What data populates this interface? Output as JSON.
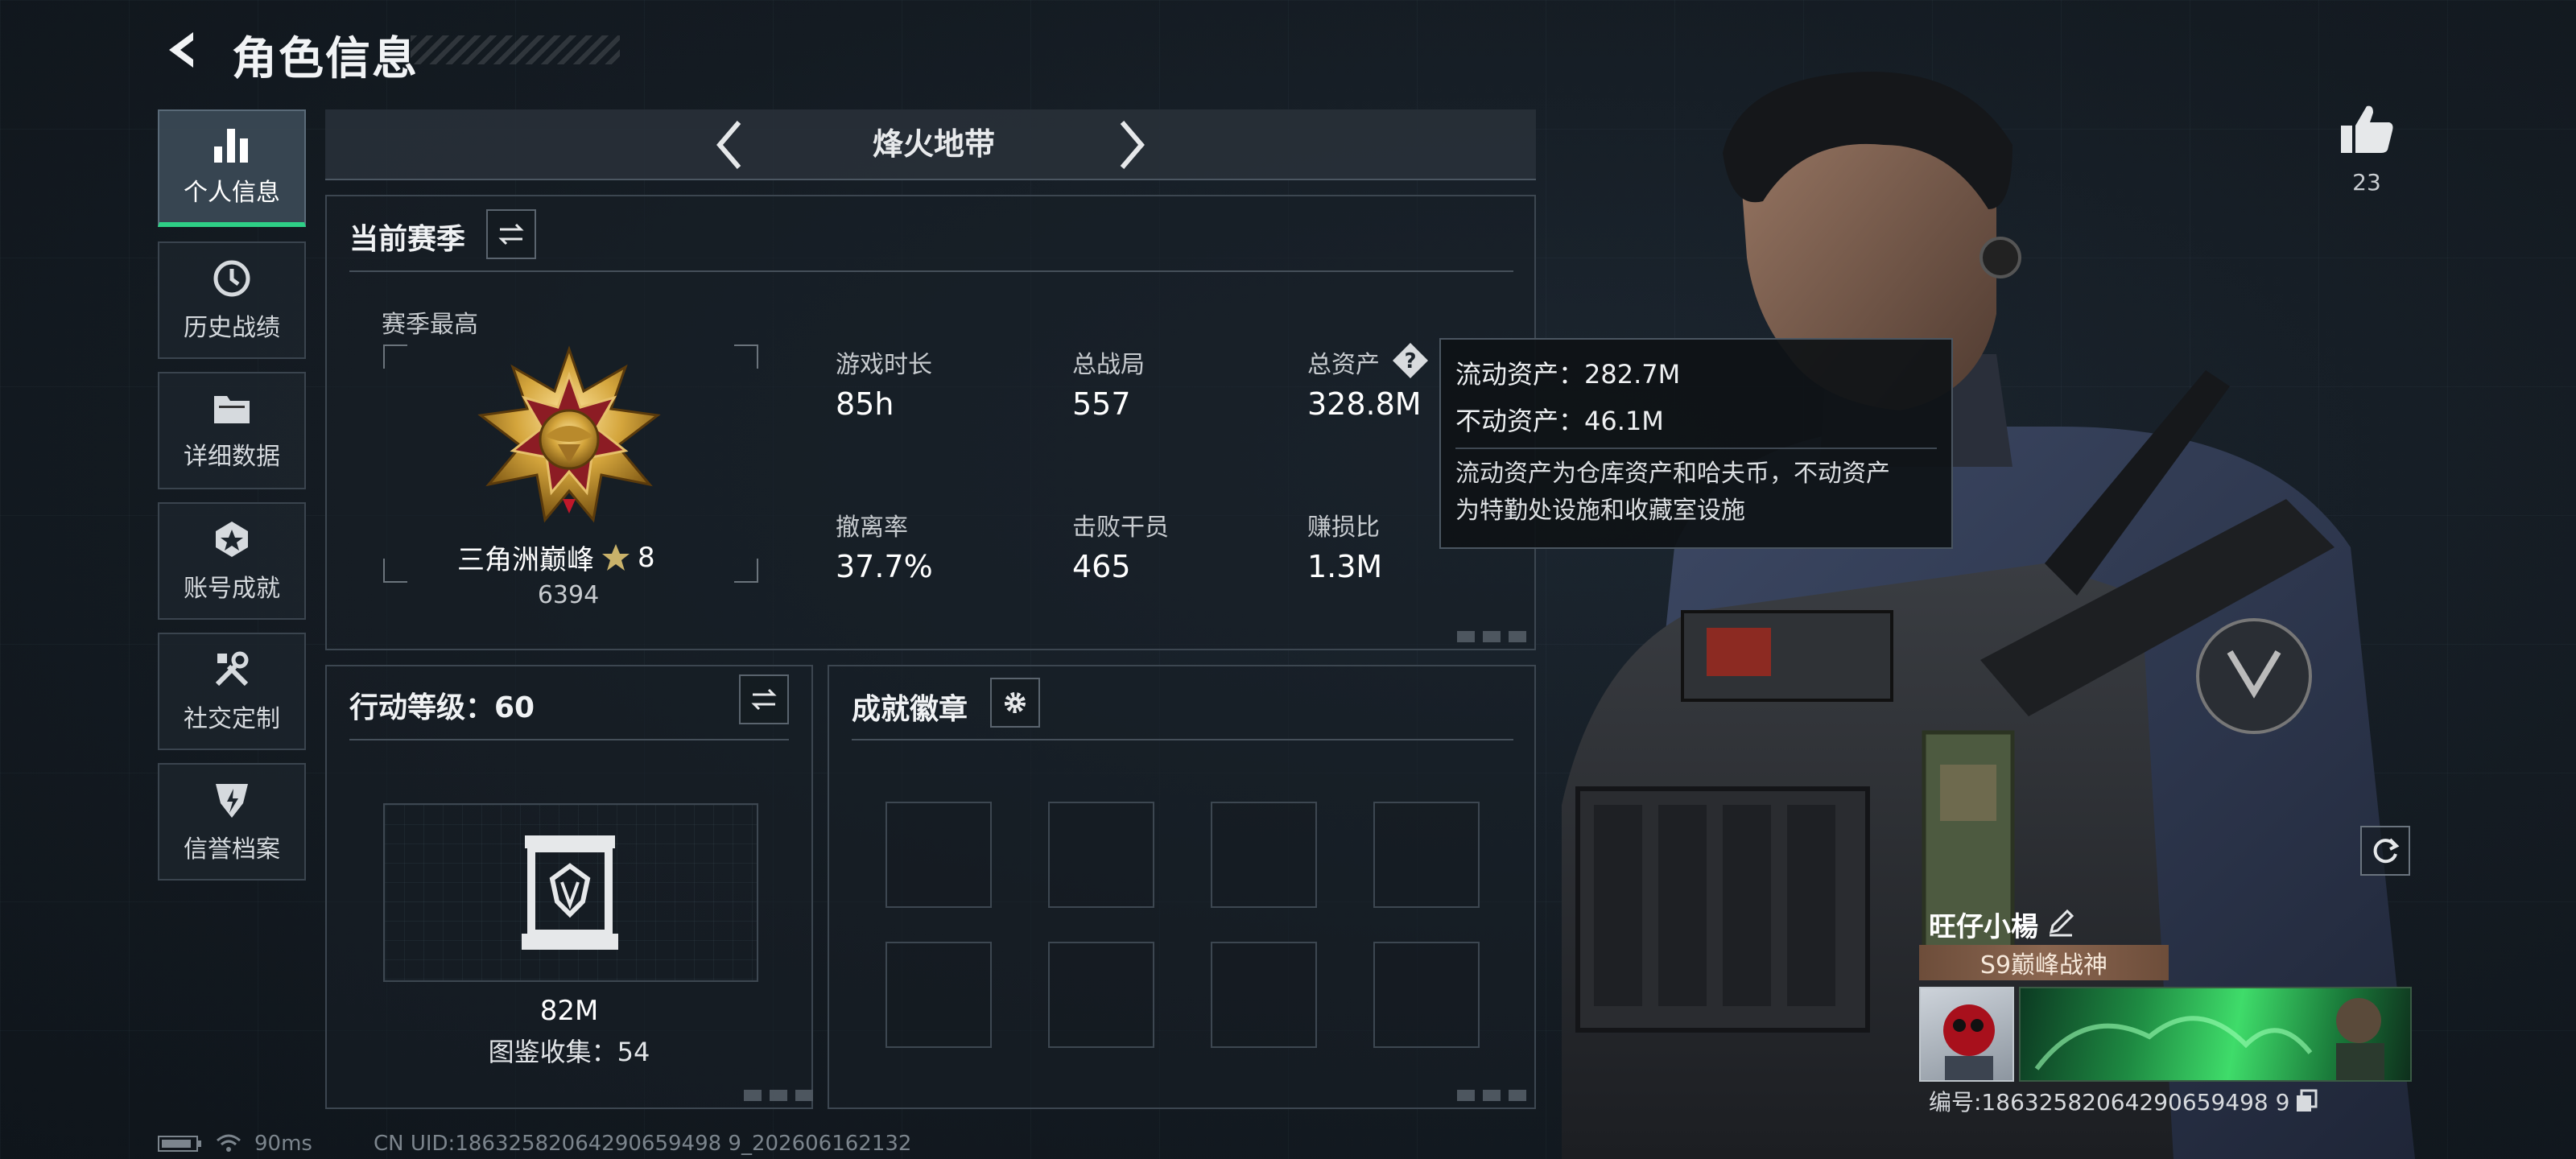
{
  "header": {
    "title": "角色信息"
  },
  "sidebar": {
    "items": [
      {
        "label": "个人信息",
        "icon": "bar-chart-icon",
        "active": true
      },
      {
        "label": "历史战绩",
        "icon": "history-clock-icon",
        "active": false
      },
      {
        "label": "详细数据",
        "icon": "folder-icon",
        "active": false
      },
      {
        "label": "账号成就",
        "icon": "achievement-star-icon",
        "active": false
      },
      {
        "label": "社交定制",
        "icon": "tools-icon",
        "active": false
      },
      {
        "label": "信誉档案",
        "icon": "credit-shield-icon",
        "active": false
      }
    ]
  },
  "mode": {
    "title": "烽火地带"
  },
  "season": {
    "title": "当前赛季",
    "best_label": "赛季最高",
    "rank_name": "三角洲巅峰",
    "rank_stars": "8",
    "rank_score": "6394",
    "stats": [
      {
        "label": "游戏时长",
        "value": "85h"
      },
      {
        "label": "总战局",
        "value": "557"
      },
      {
        "label": "总资产",
        "value": "328.8M"
      },
      {
        "label": "撤离率",
        "value": "37.7%"
      },
      {
        "label": "击败干员",
        "value": "465"
      },
      {
        "label": "赚损比",
        "value": "1.3M"
      }
    ]
  },
  "tooltip": {
    "liquid": "流动资产：282.7M",
    "fixed": "不动资产：46.1M",
    "desc_line1": "流动资产为仓库资产和哈夫币，不动资产",
    "desc_line2": "为特勤处设施和收藏室设施"
  },
  "action_level": {
    "title": "行动等级：60",
    "value": "82M",
    "collection": "图鉴收集：54"
  },
  "badges": {
    "title": "成就徽章",
    "slots": 8
  },
  "profile": {
    "name": "旺仔小楊",
    "title": "S9巅峰战神",
    "serial": "编号:18632582064290659498 9",
    "likes": "23"
  },
  "status": {
    "ping": "90ms",
    "uid": "CN UID:18632582064290659498 9_202606162132"
  },
  "colors": {
    "accent_green": "#2ecf86",
    "banner_green": "#3fdc6a",
    "gold": "#d4a53c"
  }
}
